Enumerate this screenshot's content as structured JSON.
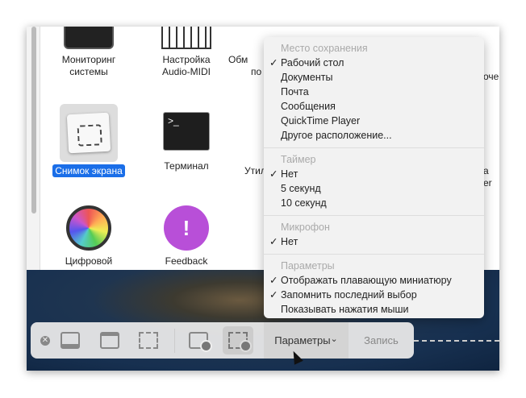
{
  "apps": [
    {
      "line1": "Мониторинг",
      "line2": "системы"
    },
    {
      "line1": "Настройка",
      "line2": "Audio-MIDI"
    },
    {
      "line1": "Обм",
      "line2": "по"
    },
    {
      "line1": "Снимок экрана",
      "line2": ""
    },
    {
      "line1": "Терминал",
      "line2": ""
    },
    {
      "line1": "Утил",
      "line2": ""
    },
    {
      "line1": "Цифровой",
      "line2": ""
    },
    {
      "line1": "Feedback",
      "line2": ""
    },
    {
      "line1": "оче",
      "line2": ""
    },
    {
      "line1": "а",
      "line2": "er"
    }
  ],
  "menu": {
    "save_header": "Место сохранения",
    "save_items": [
      {
        "label": "Рабочий стол",
        "checked": true
      },
      {
        "label": "Документы"
      },
      {
        "label": "Почта"
      },
      {
        "label": "Сообщения"
      },
      {
        "label": "QuickTime Player"
      },
      {
        "label": "Другое расположение..."
      }
    ],
    "timer_header": "Таймер",
    "timer_items": [
      {
        "label": "Нет",
        "checked": true
      },
      {
        "label": "5 секунд"
      },
      {
        "label": "10 секунд"
      }
    ],
    "mic_header": "Микрофон",
    "mic_items": [
      {
        "label": "Нет",
        "checked": true
      }
    ],
    "opt_header": "Параметры",
    "opt_items": [
      {
        "label": "Отображать плавающую миниатюру",
        "checked": true
      },
      {
        "label": "Запомнить последний выбор",
        "checked": true
      },
      {
        "label": "Показывать нажатия мыши"
      }
    ],
    "check": "✓"
  },
  "toolbar": {
    "options_label": "Параметры",
    "record_label": "Запись",
    "chevron": "⌄"
  }
}
